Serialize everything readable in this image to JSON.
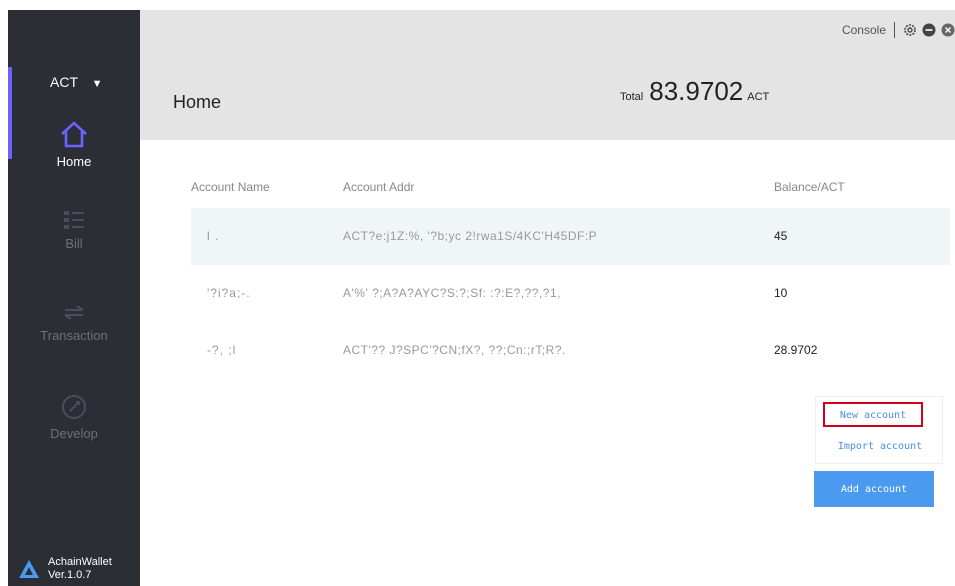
{
  "sidebar": {
    "coin": "ACT",
    "caret": "▼",
    "nav": [
      {
        "label": "Home",
        "icon": "home-icon"
      },
      {
        "label": "Bill",
        "icon": "bill-icon"
      },
      {
        "label": "Transaction",
        "icon": "transaction-icon"
      },
      {
        "label": "Develop",
        "icon": "develop-icon"
      }
    ],
    "brand_name": "AchainWallet",
    "version": "Ver.1.0.7"
  },
  "topbar": {
    "console": "Console",
    "icons": [
      "settings-icon",
      "minimize-icon",
      "close-icon"
    ]
  },
  "header": {
    "title": "Home",
    "total_label": "Total",
    "total_amount": "83.9702",
    "total_unit": "ACT"
  },
  "table": {
    "columns": [
      "Account Name",
      "Account Addr",
      "Balance/ACT"
    ],
    "rows": [
      {
        "name": "l .",
        "addr": "ACT?e:j1Z:%,  '?b;yc  2!rwa1S/4KC'H45DF:P",
        "balance": "45"
      },
      {
        "name": "'?i?a;-.",
        "addr": "A'%' ?;A?A?AYC?S:?;Sf:   :?:E?,??,?1,",
        "balance": "10"
      },
      {
        "name": "-?, ;l",
        "addr": "ACT'??  J?SPC'?CN;fX?,  ??;Cn:;rT;R?.",
        "balance": "28.9702"
      }
    ]
  },
  "actions": {
    "new_account": "New account",
    "import_account": "Import account",
    "add_account": "Add account"
  },
  "colors": {
    "sidebar_bg": "#2b2e35",
    "accent": "#6b63ff",
    "header_bg": "#e4e4e4",
    "button_blue": "#4a9bf0",
    "highlight_red": "#d0021b"
  }
}
